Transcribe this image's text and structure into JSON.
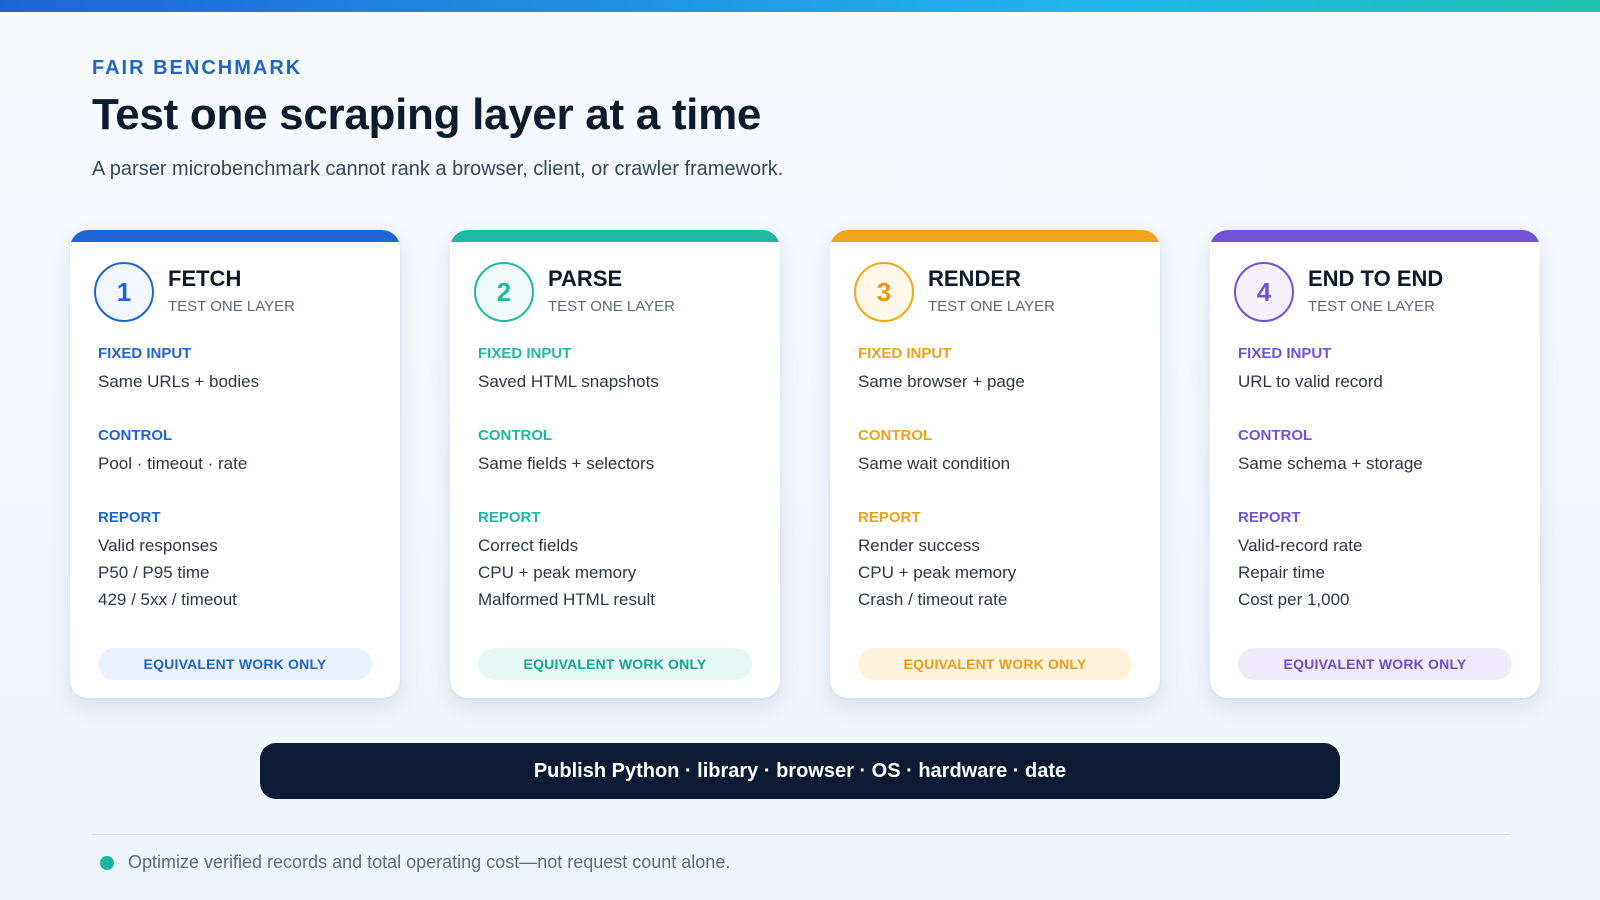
{
  "header": {
    "eyebrow": "FAIR BENCHMARK",
    "title": "Test one scraping layer at a time",
    "subtitle": "A parser microbenchmark cannot rank a browser, client, or crawler framework."
  },
  "colors": {
    "blue": "#1f65d3",
    "teal": "#1fb8a3",
    "orange": "#f4a51c",
    "purple": "#7152d8"
  },
  "cards": [
    {
      "num": "1",
      "name": "FETCH",
      "sub": "TEST ONE LAYER",
      "fixed_label": "FIXED INPUT",
      "fixed": "Same URLs + bodies",
      "control_label": "CONTROL",
      "control": "Pool · timeout · rate",
      "report_label": "REPORT",
      "report": [
        "Valid responses",
        "P50 / P95 time",
        "429 / 5xx / timeout"
      ],
      "pill": "EQUIVALENT WORK ONLY"
    },
    {
      "num": "2",
      "name": "PARSE",
      "sub": "TEST ONE LAYER",
      "fixed_label": "FIXED INPUT",
      "fixed": "Saved HTML snapshots",
      "control_label": "CONTROL",
      "control": "Same fields + selectors",
      "report_label": "REPORT",
      "report": [
        "Correct fields",
        "CPU + peak memory",
        "Malformed HTML result"
      ],
      "pill": "EQUIVALENT WORK ONLY"
    },
    {
      "num": "3",
      "name": "RENDER",
      "sub": "TEST ONE LAYER",
      "fixed_label": "FIXED INPUT",
      "fixed": "Same browser + page",
      "control_label": "CONTROL",
      "control": "Same wait condition",
      "report_label": "REPORT",
      "report": [
        "Render success",
        "CPU + peak memory",
        "Crash / timeout rate"
      ],
      "pill": "EQUIVALENT WORK ONLY"
    },
    {
      "num": "4",
      "name": "END TO END",
      "sub": "TEST ONE LAYER",
      "fixed_label": "FIXED INPUT",
      "fixed": "URL to valid record",
      "control_label": "CONTROL",
      "control": "Same schema + storage",
      "report_label": "REPORT",
      "report": [
        "Valid-record rate",
        "Repair time",
        "Cost per 1,000"
      ],
      "pill": "EQUIVALENT WORK ONLY"
    }
  ],
  "publish": "Publish Python · library · browser · OS · hardware · date",
  "footnote": "Optimize verified records and total operating cost—not request count alone."
}
